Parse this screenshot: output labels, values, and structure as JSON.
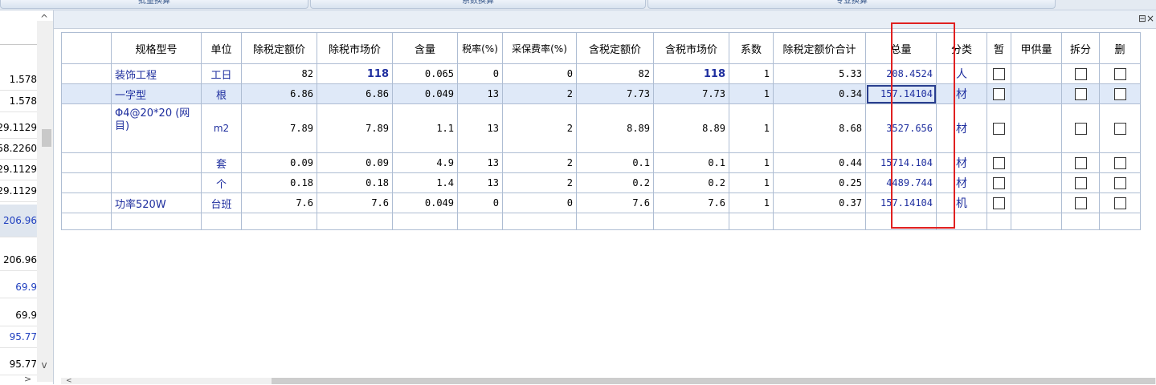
{
  "top_tabs": [
    "批量换算",
    "系数换算",
    "专业换算"
  ],
  "left_list": {
    "items": [
      {
        "text": "1.578",
        "blue": false,
        "selected": false
      },
      {
        "text": "1.578",
        "blue": false,
        "selected": false
      },
      {
        "text": "29.1129",
        "blue": false,
        "selected": false
      },
      {
        "text": "58.2260",
        "blue": false,
        "selected": false
      },
      {
        "text": "29.1129",
        "blue": false,
        "selected": false
      },
      {
        "text": "29.1129",
        "blue": false,
        "selected": false
      },
      {
        "text": "206.96",
        "blue": true,
        "selected": true
      },
      {
        "text": "206.96",
        "blue": false,
        "selected": false
      },
      {
        "text": "69.9",
        "blue": true,
        "selected": false
      },
      {
        "text": "69.9",
        "blue": false,
        "selected": false
      },
      {
        "text": "95.77",
        "blue": true,
        "selected": false
      },
      {
        "text": "95.77",
        "blue": false,
        "selected": false
      }
    ]
  },
  "grid": {
    "headers": [
      "",
      "规格型号",
      "单位",
      "除税定额价",
      "除税市场价",
      "含量",
      "税率(%)",
      "采保费率(%)",
      "含税定额价",
      "含税市场价",
      "系数",
      "除税定额价合计",
      "总量",
      "分类",
      "暂",
      "甲供量",
      "拆分",
      "删"
    ],
    "rows": [
      {
        "blank": "",
        "spec": "装饰工程",
        "unit": "工日",
        "dq_ex": "82",
        "mk_ex": "118",
        "content": "0.065",
        "tax": "0",
        "fee": "0",
        "dq_in": "82",
        "mk_in": "118",
        "coef": "1",
        "sum_ex": "5.33",
        "total": "208.4524",
        "cat": "人",
        "supply": ""
      },
      {
        "blank": "",
        "spec": "一字型",
        "unit": "根",
        "dq_ex": "6.86",
        "mk_ex": "6.86",
        "content": "0.049",
        "tax": "13",
        "fee": "2",
        "dq_in": "7.73",
        "mk_in": "7.73",
        "coef": "1",
        "sum_ex": "0.34",
        "total": "157.14104",
        "cat": "材",
        "supply": ""
      },
      {
        "blank": "",
        "spec": "Φ4@20*20 (网目)",
        "unit": "m2",
        "dq_ex": "7.89",
        "mk_ex": "7.89",
        "content": "1.1",
        "tax": "13",
        "fee": "2",
        "dq_in": "8.89",
        "mk_in": "8.89",
        "coef": "1",
        "sum_ex": "8.68",
        "total": "3527.656",
        "cat": "材",
        "supply": ""
      },
      {
        "blank": "",
        "spec": "",
        "unit": "套",
        "dq_ex": "0.09",
        "mk_ex": "0.09",
        "content": "4.9",
        "tax": "13",
        "fee": "2",
        "dq_in": "0.1",
        "mk_in": "0.1",
        "coef": "1",
        "sum_ex": "0.44",
        "total": "15714.104",
        "cat": "材",
        "supply": ""
      },
      {
        "blank": "",
        "spec": "",
        "unit": "个",
        "dq_ex": "0.18",
        "mk_ex": "0.18",
        "content": "1.4",
        "tax": "13",
        "fee": "2",
        "dq_in": "0.2",
        "mk_in": "0.2",
        "coef": "1",
        "sum_ex": "0.25",
        "total": "4489.744",
        "cat": "材",
        "supply": ""
      },
      {
        "blank": "",
        "spec": "功率520W",
        "unit": "台班",
        "dq_ex": "7.6",
        "mk_ex": "7.6",
        "content": "0.049",
        "tax": "0",
        "fee": "0",
        "dq_in": "7.6",
        "mk_in": "7.6",
        "coef": "1",
        "sum_ex": "0.37",
        "total": "157.14104",
        "cat": "机",
        "supply": ""
      }
    ]
  },
  "colors": {
    "highlight_box": "#e02020",
    "link_blue": "#1f2f9f",
    "selected_row": "#dfe9f8"
  }
}
